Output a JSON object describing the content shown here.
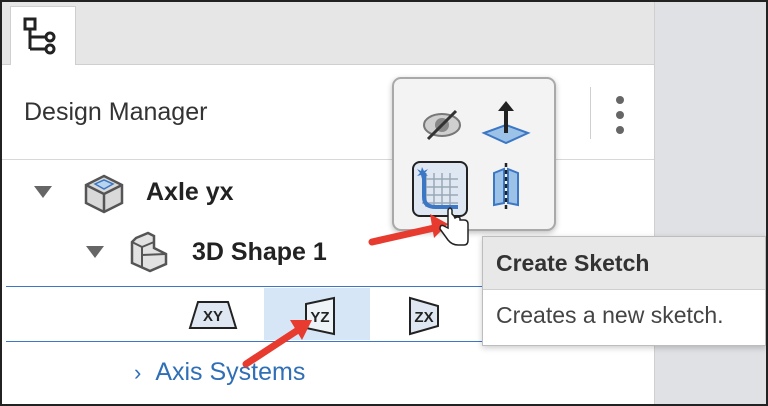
{
  "panel": {
    "title": "Design Manager"
  },
  "tree": {
    "root": {
      "label": "Axle yx"
    },
    "child": {
      "label": "3D Shape 1"
    },
    "planes": [
      {
        "label": "XY"
      },
      {
        "label": "YZ"
      },
      {
        "label": "ZX"
      }
    ],
    "axis_systems": {
      "label": "Axis Systems",
      "chevron": "›"
    }
  },
  "tooltip": {
    "title": "Create Sketch",
    "description": "Creates a new sketch."
  },
  "colors": {
    "accent": "#3b77c5",
    "arrow": "#e63b2e",
    "link": "#2f6fb6",
    "selection": "#d6e6f6"
  },
  "icons": {
    "tab": "tree-hierarchy-icon",
    "root": "part-icon",
    "child": "3d-shape-icon",
    "popup": [
      "hide-eye-icon",
      "pull-arrow-icon",
      "create-sketch-icon",
      "mirror-plane-icon"
    ]
  }
}
